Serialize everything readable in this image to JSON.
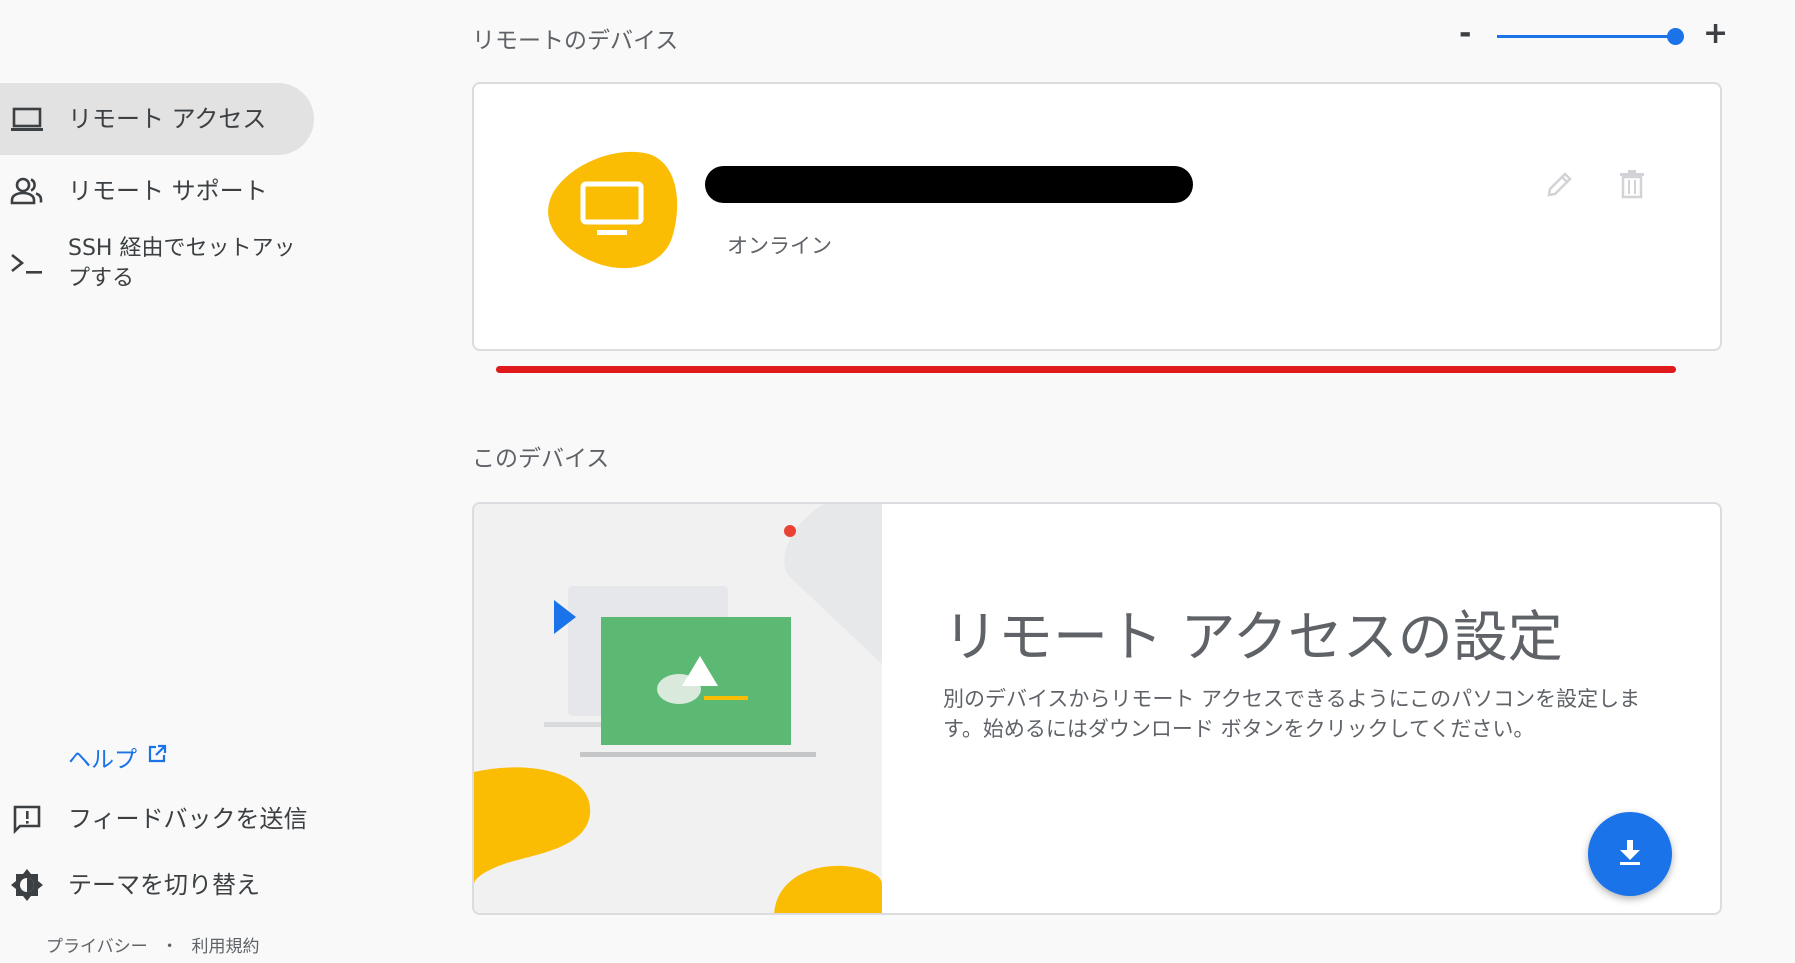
{
  "sidebar": {
    "items": [
      {
        "label": "リモート アクセス",
        "icon": "laptop-icon"
      },
      {
        "label": "リモート サポート",
        "icon": "people-icon"
      },
      {
        "label": "SSH 経由でセットアップする",
        "icon": "terminal-icon"
      }
    ],
    "help_label": "ヘルプ",
    "feedback_label": "フィードバックを送信",
    "theme_label": "テーマを切り替え",
    "footer": {
      "privacy": "プライバシー",
      "separator": "・",
      "terms": "利用規約"
    }
  },
  "remote_devices": {
    "title": "リモートのデバイス",
    "device": {
      "status": "オンライン",
      "name_redacted": true
    }
  },
  "zoom": {
    "minus": "-",
    "plus": "+",
    "level": 1.0
  },
  "this_device": {
    "title": "このデバイス",
    "setup_title": "リモート アクセスの設定",
    "setup_desc": "別のデバイスからリモート アクセスできるようにこのパソコンを設定します。始めるにはダウンロード ボタンをクリックしてください。"
  },
  "colors": {
    "accent": "#1a73e8",
    "yellow": "#fbbc04",
    "green": "#5bb974",
    "red": "#e0191b",
    "active_nav": "#e2e2e2"
  }
}
